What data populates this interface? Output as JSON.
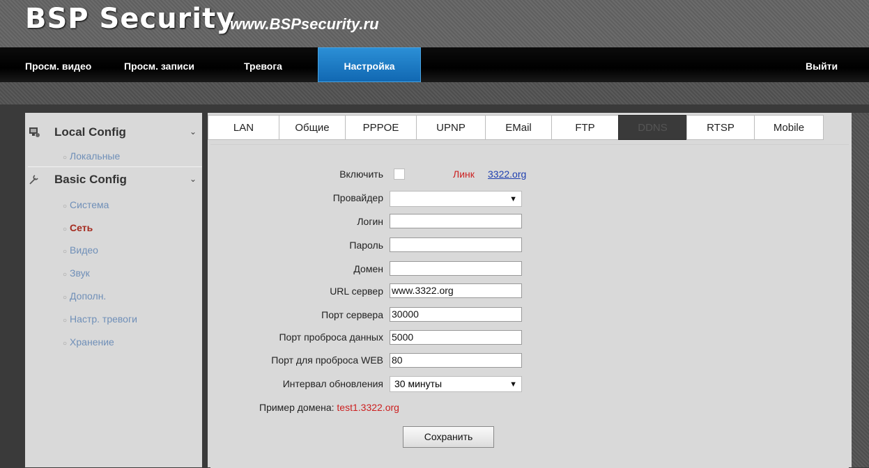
{
  "header": {
    "logo": "BSP Security",
    "site": "www.BSPsecurity.ru"
  },
  "nav": {
    "items": [
      "Просм. видео",
      "Просм. записи",
      "Тревога",
      "Настройка"
    ],
    "active": "Настройка",
    "logout": "Выйти"
  },
  "sidebar": {
    "local_config": {
      "title": "Local Config",
      "items": [
        "Локальные"
      ]
    },
    "basic_config": {
      "title": "Basic Config",
      "items": [
        "Система",
        "Сеть",
        "Видео",
        "Звук",
        "Дополн.",
        "Настр. тревоги",
        "Хранение"
      ]
    },
    "current": "Сеть"
  },
  "tabs": [
    "LAN",
    "Общие",
    "PPPOE",
    "UPNP",
    "EMail",
    "FTP",
    "DDNS",
    "RTSP",
    "Mobile"
  ],
  "form": {
    "enable_label": "Включить",
    "link_label": "Линк",
    "link_value": "3322.org",
    "provider_label": "Провайдер",
    "provider_value": "",
    "login_label": "Логин",
    "password_label": "Пароль",
    "domain_label": "Домен",
    "url_label": "URL сервер",
    "url_value": "www.3322.org",
    "server_port_label": "Порт сервера",
    "server_port_value": "30000",
    "data_port_label": "Порт проброса данных",
    "data_port_value": "5000",
    "web_port_label": "Порт для проброса WEB",
    "web_port_value": "80",
    "interval_label": "Интервал обновления",
    "interval_value": "30 минуты",
    "example_label": "Пример домена:",
    "example_value": "test1.3322.org",
    "save_label": "Сохранить"
  },
  "colors": {
    "accent": "#1a78c4",
    "link": "#1e3fb0",
    "current_item": "#a42a1e",
    "red_text": "#cc1f1f"
  }
}
